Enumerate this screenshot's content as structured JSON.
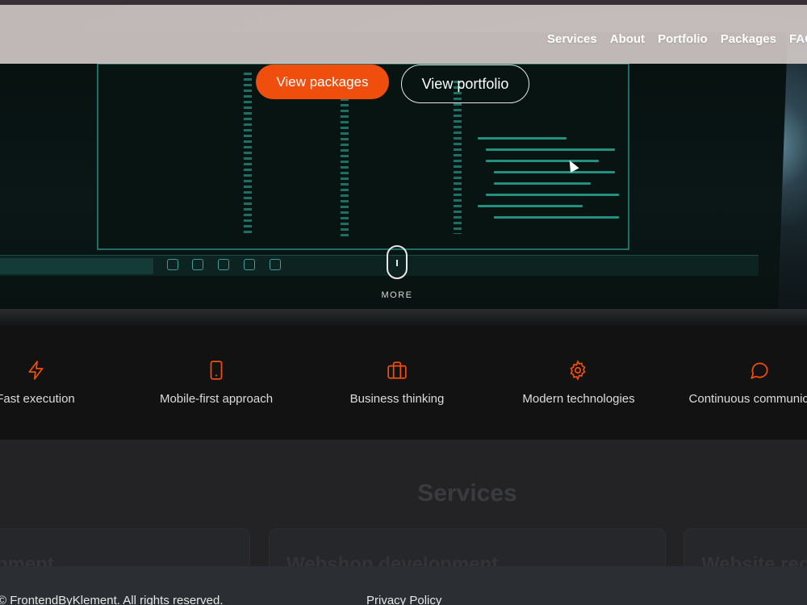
{
  "nav": {
    "links": [
      "Services",
      "About",
      "Portfolio",
      "Packages",
      "FAQ"
    ]
  },
  "hero": {
    "primary_button": "View packages",
    "secondary_button": "View portfolio",
    "scroll_label": "MORE"
  },
  "features": [
    {
      "icon": "lightning-icon",
      "label": "Fast execution"
    },
    {
      "icon": "smartphone-icon",
      "label": "Mobile-first approach"
    },
    {
      "icon": "briefcase-icon",
      "label": "Business thinking"
    },
    {
      "icon": "gear-icon",
      "label": "Modern technologies"
    },
    {
      "icon": "chat-bubble-icon",
      "label": "Continuous communication"
    }
  ],
  "services": {
    "title": "Services",
    "cards": [
      "Web development",
      "Webshop development",
      "Website redesign"
    ]
  },
  "footer": {
    "copyright": "© FrontendByKlement. All rights reserved.",
    "privacy_link": "Privacy Policy"
  },
  "colors": {
    "accent": "#f04e0c",
    "feature_bg": "#121212",
    "services_bg": "#232325",
    "footer_bg": "#2b2e32"
  }
}
